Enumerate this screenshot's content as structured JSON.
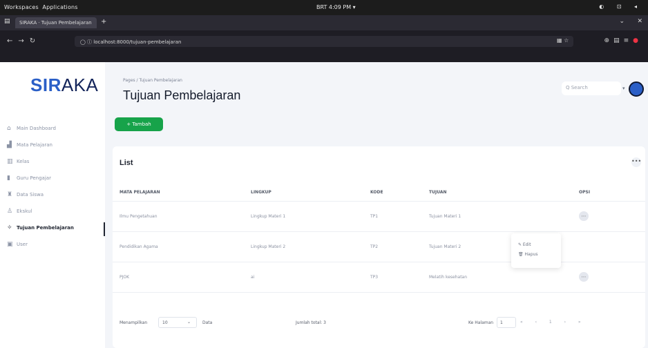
{
  "os": {
    "activities": "Workspaces",
    "applications": "Applications",
    "clock": "BRT 4:09 PM ▾",
    "sys_icons": "◐ ⊡ ◂"
  },
  "browser": {
    "tab_title": "SIRAKA · Tujuan Pembelajaran",
    "url": "localhost:8000/tujuan-pembelajaran",
    "url_prefix": "◯ ⓘ"
  },
  "sidebar": {
    "logo_part1": "SIR",
    "logo_part2": "AKA",
    "items": [
      {
        "label": "Main Dashboard",
        "icon": "home-icon",
        "glyph": "⌂"
      },
      {
        "label": "Mata Pelajaran",
        "icon": "chart-icon",
        "glyph": "▟"
      },
      {
        "label": "Kelas",
        "icon": "grid-icon",
        "glyph": "▥"
      },
      {
        "label": "Guru Pengajar",
        "icon": "bars-icon",
        "glyph": "▮"
      },
      {
        "label": "Data Siswa",
        "icon": "user-icon",
        "glyph": "♜"
      },
      {
        "label": "Ekskul",
        "icon": "people-icon",
        "glyph": "♙"
      },
      {
        "label": "Tujuan Pembelajaran",
        "icon": "target-icon",
        "glyph": "✧"
      },
      {
        "label": "User",
        "icon": "user-icon",
        "glyph": "▣"
      }
    ],
    "active_index": 6
  },
  "header": {
    "breadcrumb": "Pages / Tujuan Pembelajaran",
    "title": "Tujuan Pembelajaran",
    "search_placeholder": "Q Search",
    "add_button": "+ Tambah"
  },
  "card": {
    "title": "List",
    "more": "•••",
    "columns": [
      "MATA PELAJARAN",
      "LINGKUP",
      "KODE",
      "TUJUAN",
      "OPSI"
    ],
    "rows": [
      [
        "Ilmu Pengetahuan",
        "Lingkup Materi 1",
        "TP1",
        "Tujuan Materi 1",
        "⋯"
      ],
      [
        "Pendidikan Agama",
        "Lingkup Materi 2",
        "TP2",
        "Tujuan Materi 2",
        ""
      ],
      [
        "PJOK",
        "ai",
        "TP3",
        "Melatih kesehatan",
        "⋯"
      ]
    ],
    "dropdown": [
      "✎ Edit",
      "🗑 Hapus"
    ]
  },
  "footer": {
    "show_label": "Menampilkan",
    "page_size": "10",
    "data_label": "Data",
    "total_label": "Jumlah total: 3",
    "page_label": "Ke Halaman",
    "page_number": "1",
    "pager": "« ‹ 1 › »"
  }
}
